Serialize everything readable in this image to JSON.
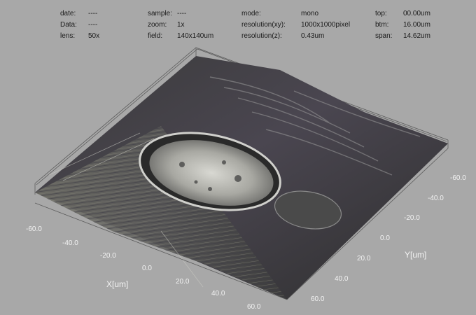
{
  "info": {
    "date": {
      "label": "date:",
      "value": "----"
    },
    "data": {
      "label": "Data:",
      "value": "----"
    },
    "lens": {
      "label": "lens:",
      "value": "50x"
    },
    "sample": {
      "label": "sample:",
      "value": "----"
    },
    "zoom": {
      "label": "zoom:",
      "value": "1x"
    },
    "field": {
      "label": "field:",
      "value": "140x140um"
    },
    "mode": {
      "label": "mode:",
      "value": "mono"
    },
    "res_xy": {
      "label": "resolution(xy):",
      "value": "1000x1000pixel"
    },
    "res_z": {
      "label": "resolution(z):",
      "value": "0.43um"
    },
    "top": {
      "label": "top:",
      "value": "00.00um"
    },
    "btm": {
      "label": "btm:",
      "value": "16.00um"
    },
    "span": {
      "label": "span:",
      "value": "14.62um"
    }
  },
  "axes": {
    "x_title": "X[um]",
    "y_title": "Y[um]",
    "x_ticks": [
      "-60.0",
      "-40.0",
      "-20.0",
      "0.0",
      "20.0",
      "40.0",
      "60.0"
    ],
    "y_ticks": [
      "-60.0",
      "-40.0",
      "-20.0",
      "0.0",
      "20.0",
      "40.0",
      "60.0"
    ]
  },
  "colors": {
    "background": "#a8a8a8",
    "text": "#1a1a1a",
    "tick_text": "#f2f2f2"
  }
}
